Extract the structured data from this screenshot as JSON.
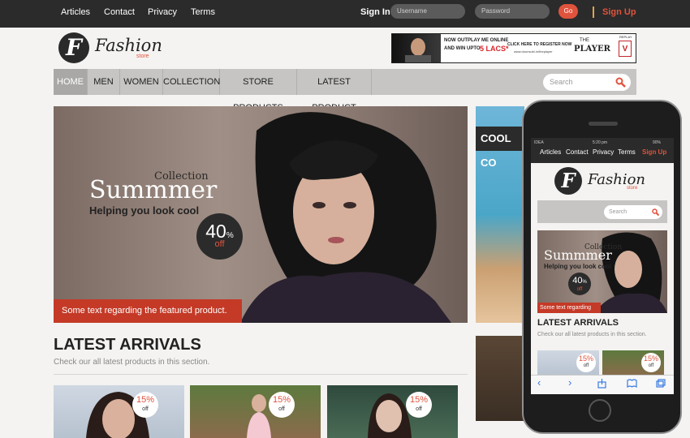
{
  "topbar": {
    "links": [
      "Articles",
      "Contact",
      "Privacy",
      "Terms"
    ],
    "signin_label": "Sign In",
    "username_placeholder": "Username",
    "password_placeholder": "Password",
    "go_label": "Go",
    "signup_label": "Sign Up"
  },
  "brand": {
    "name": "Fashion",
    "sub": "store",
    "logo_letter": "F"
  },
  "ad": {
    "line1": "NOW OUTPLAY ME ONLINE",
    "line2": "AND WIN UPTO",
    "amount": "5 LACS*",
    "cta": "CLICK HERE TO REGISTER NOW",
    "url": "www.doonsubi.in/theplayer",
    "brand_small": "THE",
    "brand_big": "PLAYER",
    "replay_label": "REPLAY",
    "v_label": "V"
  },
  "nav": {
    "items": [
      "HOME",
      "MEN",
      "WOMEN",
      "COLLECTION",
      "STORE PRODUCTS",
      "LATEST PRODUCT"
    ],
    "search_placeholder": "Search"
  },
  "hero": {
    "collection": "Collection",
    "title": "Summmer",
    "tagline": "Helping you look cool",
    "discount": "40",
    "discount_pct": "%",
    "discount_off": "off",
    "caption": "Some text regarding the featured product."
  },
  "side_banner": {
    "text": "COOL CO"
  },
  "latest": {
    "title": "LATEST ARRIVALS",
    "subtitle": "Check our all latest products in this section.",
    "badge_value": "15%",
    "badge_off": "off"
  },
  "phone": {
    "carrier": "IDEA",
    "time": "5:20 pm",
    "battery": "90%",
    "links": [
      "Articles",
      "Contact",
      "Privacy",
      "Terms"
    ],
    "signup": "Sign Up",
    "search_placeholder": "Search",
    "hero_caption": "Some text regarding"
  },
  "colors": {
    "accent": "#e0533d",
    "topbar": "#2b2b2b",
    "nav": "#c6c5c3"
  }
}
